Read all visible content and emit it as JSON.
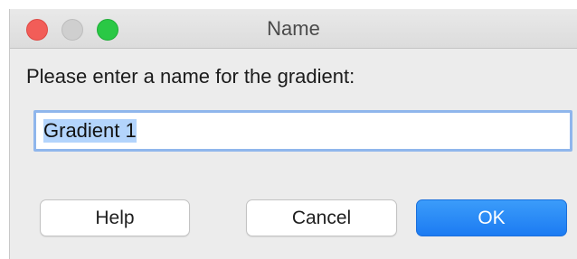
{
  "window": {
    "title": "Name"
  },
  "dialog": {
    "prompt": "Please enter a name for the gradient:",
    "name_field": {
      "value": "Gradient 1",
      "selected": true
    },
    "buttons": {
      "help_label": "Help",
      "cancel_label": "Cancel",
      "ok_label": "OK"
    }
  },
  "colors": {
    "close": "#f25d58",
    "minimize": "#cfcfcf",
    "maximize": "#2ac845",
    "primary_button": "#1c7bf2",
    "focus_ring": "#8fb6ec"
  }
}
